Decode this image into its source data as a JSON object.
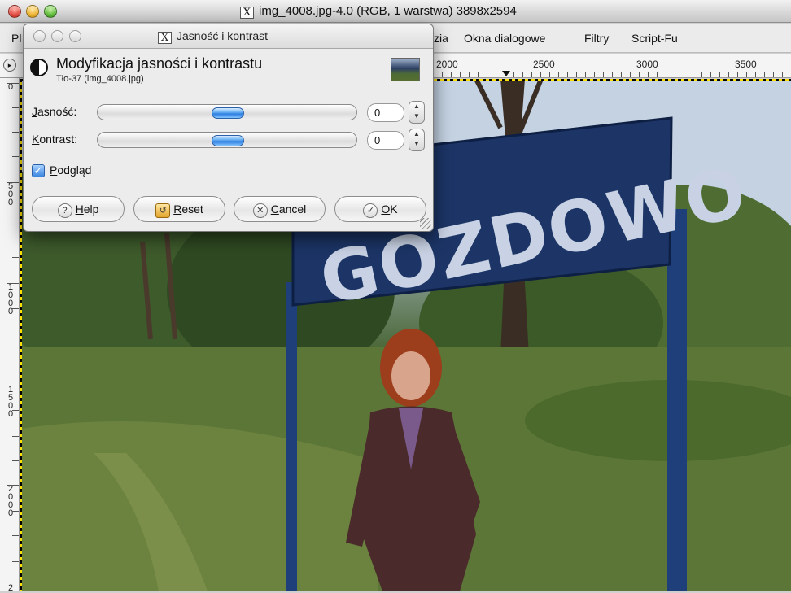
{
  "main_window": {
    "title": "img_4008.jpg-4.0 (RGB, 1 warstwa) 3898x2594",
    "title_icon": "X"
  },
  "menubar": {
    "items": [
      {
        "label": "Pl",
        "icon": "truncated"
      },
      {
        "label": "zia"
      },
      {
        "label": "Okna dialogowe"
      },
      {
        "label": "Filtry"
      },
      {
        "label": "Script-Fu"
      }
    ]
  },
  "ruler_top": {
    "labels": [
      "2000",
      "2500",
      "3000",
      "3500"
    ]
  },
  "ruler_left": {
    "labels": [
      "0",
      "5 0 0",
      "1 0 0 0",
      "1 5 0 0",
      "2 0 0 0",
      "2"
    ]
  },
  "canvas": {
    "sign_text": "GOZDOWO"
  },
  "dialog": {
    "title": "Jasność i kontrast",
    "heading": "Modyfikacja jasności i kontrastu",
    "subheading": "Tło-37 (img_4008.jpg)",
    "brightness": {
      "label": "Jasność:",
      "mnemonic": "J",
      "rest": "asność:",
      "value": "0",
      "level": 0
    },
    "contrast": {
      "label": "Kontrast:",
      "mnemonic": "K",
      "rest": "ontrast:",
      "value": "0",
      "level": 0
    },
    "preview": {
      "label": "Podgląd",
      "mnemonic": "P",
      "rest": "odgląd",
      "checked": true
    },
    "buttons": {
      "help": {
        "mnemonic": "H",
        "rest": "elp",
        "icon": "question-mark-icon"
      },
      "reset": {
        "mnemonic": "R",
        "rest": "eset",
        "icon": "reset-icon"
      },
      "cancel": {
        "mnemonic": "C",
        "rest": "ancel",
        "icon": "cancel-icon"
      },
      "ok": {
        "mnemonic": "O",
        "rest": "K",
        "icon": "check-icon"
      }
    }
  },
  "colors": {
    "selection": "#ffe100",
    "knob": "#2e7fe0",
    "sign_blue": "#1c3566"
  }
}
